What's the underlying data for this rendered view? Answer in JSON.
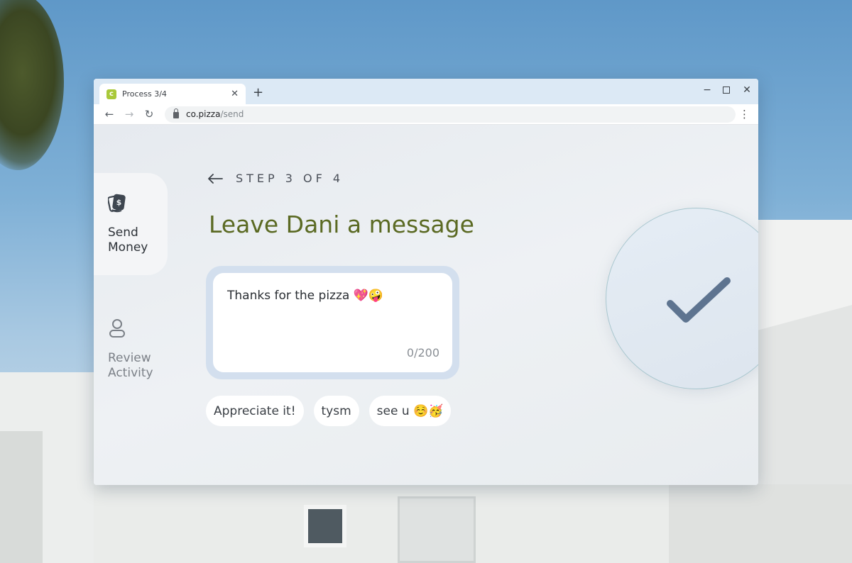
{
  "browser": {
    "tab_title": "Process 3/4",
    "favicon_letter": "c",
    "url_host": "co.pizza",
    "url_path": "/send",
    "new_tab_label": "+",
    "accent": "#a9c93a"
  },
  "sidebar": {
    "items": [
      {
        "label": "Send\nMoney",
        "icon": "money-transfer-icon",
        "active": true
      },
      {
        "label": "Review\nActivity",
        "icon": "user-icon",
        "active": false
      }
    ]
  },
  "main": {
    "step_text": "STEP 3 OF 4",
    "heading": "Leave Dani a message",
    "heading_color": "#5b6a23",
    "message": {
      "value": "Thanks for the pizza 💖🤪",
      "counter": "0/200"
    },
    "chips": [
      {
        "label": "Appreciate it!"
      },
      {
        "label": "tysm"
      },
      {
        "label": "see u ☺️🥳"
      }
    ],
    "confirm_icon": "checkmark-icon"
  }
}
